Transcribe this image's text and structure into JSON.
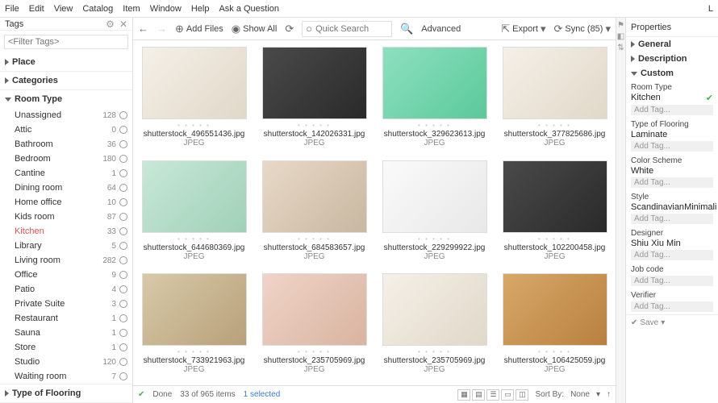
{
  "menu": {
    "items": [
      "File",
      "Edit",
      "View",
      "Catalog",
      "Item",
      "Window",
      "Help",
      "Ask a Question"
    ],
    "right": "L"
  },
  "sidebar": {
    "title": "Tags",
    "filter_placeholder": "<Filter Tags>",
    "sections": [
      {
        "label": "Place",
        "expanded": false
      },
      {
        "label": "Categories",
        "expanded": false
      },
      {
        "label": "Room Type",
        "expanded": true,
        "items": [
          {
            "name": "Unassigned",
            "count": 128
          },
          {
            "name": "Attic",
            "count": 0
          },
          {
            "name": "Bathroom",
            "count": 36
          },
          {
            "name": "Bedroom",
            "count": 180
          },
          {
            "name": "Cantine",
            "count": 1
          },
          {
            "name": "Dining room",
            "count": 64
          },
          {
            "name": "Home office",
            "count": 10
          },
          {
            "name": "Kids room",
            "count": 87
          },
          {
            "name": "Kitchen",
            "count": 33,
            "selected": true
          },
          {
            "name": "Library",
            "count": 5
          },
          {
            "name": "Living room",
            "count": 282
          },
          {
            "name": "Office",
            "count": 9
          },
          {
            "name": "Patio",
            "count": 4
          },
          {
            "name": "Private Suite",
            "count": 3
          },
          {
            "name": "Restaurant",
            "count": 1
          },
          {
            "name": "Sauna",
            "count": 1
          },
          {
            "name": "Store",
            "count": 1
          },
          {
            "name": "Studio",
            "count": 120
          },
          {
            "name": "Waiting room",
            "count": 7
          }
        ]
      },
      {
        "label": "Type of Flooring",
        "expanded": false
      }
    ]
  },
  "toolbar": {
    "add_files": "Add Files",
    "show_all": "Show All",
    "search_placeholder": "Quick Search",
    "advanced": "Advanced",
    "export": "Export",
    "sync": "Sync (85)"
  },
  "grid": {
    "items": [
      {
        "file": "shutterstock_496551436.jpg",
        "type": "JPEG",
        "cls": "white"
      },
      {
        "file": "shutterstock_142026331.jpg",
        "type": "JPEG",
        "cls": "dark"
      },
      {
        "file": "shutterstock_329623613.jpg",
        "type": "JPEG",
        "cls": "green"
      },
      {
        "file": "shutterstock_377825686.jpg",
        "type": "JPEG",
        "cls": "white"
      },
      {
        "file": "shutterstock_644680369.jpg",
        "type": "JPEG",
        "cls": "mint"
      },
      {
        "file": "shutterstock_684583657.jpg",
        "type": "JPEG",
        "cls": "shelf"
      },
      {
        "file": "shutterstock_229299922.jpg",
        "type": "JPEG",
        "cls": "sketch"
      },
      {
        "file": "shutterstock_102200458.jpg",
        "type": "JPEG",
        "cls": "dark"
      },
      {
        "file": "shutterstock_733921963.jpg",
        "type": "JPEG",
        "cls": ""
      },
      {
        "file": "shutterstock_235705969.jpg",
        "type": "JPEG",
        "cls": "pink"
      },
      {
        "file": "shutterstock_235705969.jpg",
        "type": "JPEG",
        "cls": "white"
      },
      {
        "file": "shutterstock_106425059.jpg",
        "type": "JPEG",
        "cls": "wood"
      }
    ]
  },
  "status": {
    "done": "Done",
    "count": "33 of 965 items",
    "selected": "1 selected",
    "sort_label": "Sort By:",
    "sort_value": "None"
  },
  "props": {
    "title": "Properties",
    "sections": [
      "General",
      "Description",
      "Custom"
    ],
    "fields": [
      {
        "label": "Room Type",
        "value": "Kitchen",
        "check": true
      },
      {
        "label": "Type of Flooring",
        "value": "Laminate"
      },
      {
        "label": "Color Scheme",
        "value": "White"
      },
      {
        "label": "Style",
        "value": "Scandinavian",
        "extra": "Minimali"
      },
      {
        "label": "Designer",
        "value": "Shiu Xiu Min"
      },
      {
        "label": "Job code",
        "value": ""
      },
      {
        "label": "Verifier",
        "value": ""
      }
    ],
    "add_tag": "Add Tag...",
    "save": "Save"
  }
}
